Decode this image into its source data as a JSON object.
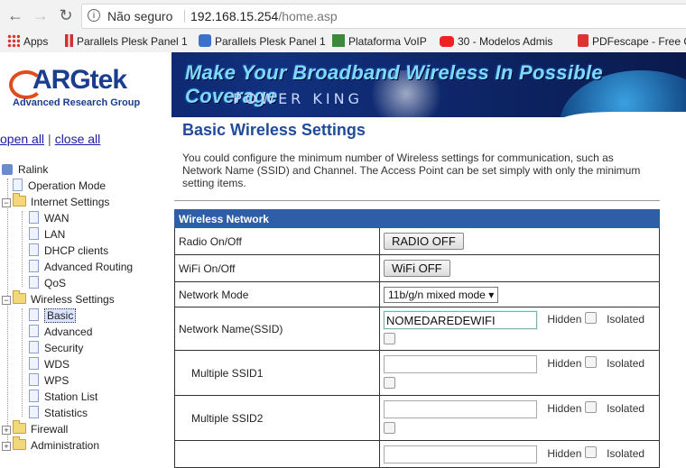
{
  "browser": {
    "security_label": "Não seguro",
    "url_host": "192.168.15.254",
    "url_path": "/home.asp",
    "bookmarks": [
      {
        "label": "Apps",
        "icon": "apps-grid-icon"
      },
      {
        "label": "Parallels Plesk Panel 1",
        "icon": "plesk-icon"
      },
      {
        "label": "Parallels Plesk Panel 1",
        "icon": "plesk-icon"
      },
      {
        "label": "Plataforma VoIP",
        "icon": "voip-icon"
      },
      {
        "label": "30 - Modelos Admis",
        "icon": "youtube-icon"
      },
      {
        "label": "PDFescape - Free O",
        "icon": "pdf-icon"
      }
    ]
  },
  "banner": {
    "logo": "ARGtek",
    "logo_sub": "Advanced Research Group",
    "title": "Make Your Broadband Wireless In Possible Coverage",
    "subtitle": "POWER KING"
  },
  "sidebar": {
    "open_all": "open all",
    "close_all": "close all",
    "separator": "|",
    "root": "Ralink",
    "items": {
      "operation_mode": "Operation Mode",
      "internet_settings": "Internet Settings",
      "wan": "WAN",
      "lan": "LAN",
      "dhcp": "DHCP clients",
      "advanced_routing": "Advanced Routing",
      "qos": "QoS",
      "wireless_settings": "Wireless Settings",
      "basic": "Basic",
      "advanced": "Advanced",
      "security": "Security",
      "wds": "WDS",
      "wps": "WPS",
      "station_list": "Station List",
      "statistics": "Statistics",
      "firewall": "Firewall",
      "administration": "Administration"
    }
  },
  "main": {
    "title": "Basic Wireless Settings",
    "description": "You could configure the minimum number of Wireless settings for communication, such as Network Name (SSID) and Channel. The Access Point can be set simply with only the minimum setting items.",
    "table_header": "Wireless Network",
    "rows": {
      "radio_label": "Radio On/Off",
      "radio_button": "RADIO OFF",
      "wifi_label": "WiFi On/Off",
      "wifi_button": "WiFi OFF",
      "mode_label": "Network Mode",
      "mode_value": "11b/g/n mixed mode",
      "ssid_label": "Network Name(SSID)",
      "ssid_value": "NOMEDAREDEWIFI",
      "ssid1_label": "Multiple SSID1",
      "ssid1_value": "",
      "ssid2_label": "Multiple SSID2",
      "ssid2_value": "",
      "hidden_label": "Hidden",
      "isolated_label": "Isolated"
    }
  }
}
